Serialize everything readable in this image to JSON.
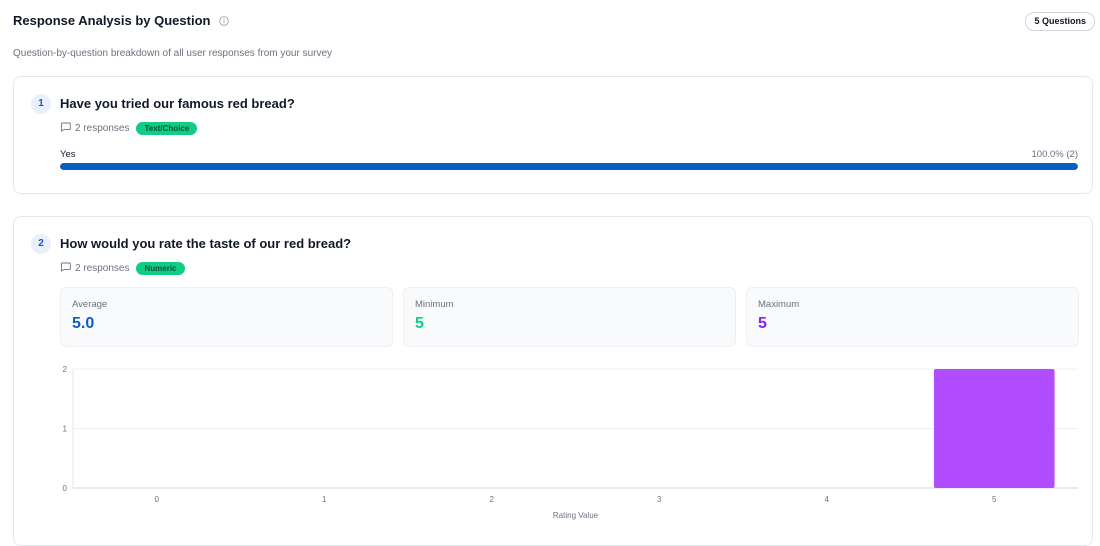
{
  "header": {
    "title": "Response Analysis by Question",
    "question_count": "5 Questions",
    "subtitle": "Question-by-question breakdown of all user responses from your survey"
  },
  "questions": [
    {
      "number": "1",
      "text": "Have you tried our famous red bread?",
      "responses": "2 responses",
      "type": "Text/Choice",
      "options": [
        {
          "label": "Yes",
          "percent_text": "100.0% (2)",
          "fraction": 1.0
        }
      ]
    },
    {
      "number": "2",
      "text": "How would you rate the taste of our red bread?",
      "responses": "2 responses",
      "type": "Numeric",
      "stats": {
        "average_label": "Average",
        "average": "5.0",
        "minimum_label": "Minimum",
        "minimum": "5",
        "maximum_label": "Maximum",
        "maximum": "5"
      }
    }
  ],
  "colors": {
    "accent_blue": "#0a5dc2",
    "badge_green": "#10cc84",
    "purple": "#8b1ef0",
    "bar_purple": "#b14dff"
  },
  "icons": {
    "title_info": "info-icon",
    "responses": "comment-icon"
  },
  "chart_data": {
    "type": "bar",
    "categories": [
      "0",
      "1",
      "2",
      "3",
      "4",
      "5"
    ],
    "values": [
      0,
      0,
      0,
      0,
      0,
      2
    ],
    "xlabel": "Rating Value",
    "ylabel": "",
    "ylim": [
      0,
      2
    ],
    "yticks": [
      "0",
      "1",
      "2"
    ],
    "grid": true
  }
}
